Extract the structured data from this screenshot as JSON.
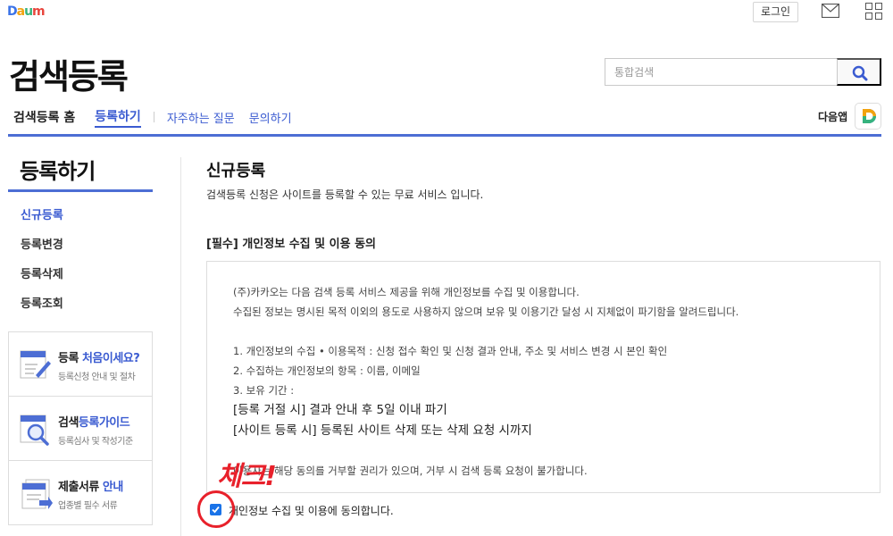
{
  "top": {
    "logo_text": "Daum",
    "login_label": "로그인"
  },
  "service_title": "검색등록",
  "search": {
    "placeholder": "통합검색"
  },
  "gnb": {
    "home": "검색등록 홈",
    "register": "등록하기",
    "faq": "자주하는 질문",
    "inquiry": "문의하기"
  },
  "app_link": "다음앱",
  "lnb": {
    "title": "등록하기",
    "items": [
      {
        "label": "신규등록",
        "active": true
      },
      {
        "label": "등록변경",
        "active": false
      },
      {
        "label": "등록삭제",
        "active": false
      },
      {
        "label": "등록조회",
        "active": false
      }
    ]
  },
  "guides": [
    {
      "title_prefix": "등록 ",
      "title_highlight": "처음이세요?",
      "title_suffix": "",
      "desc": "등록신청 안내 및 절차"
    },
    {
      "title_prefix": "검색",
      "title_highlight": "등록가이드",
      "title_suffix": "",
      "desc": "등록심사 및 작성기준"
    },
    {
      "title_prefix": "제출서류 ",
      "title_highlight": "안내",
      "title_suffix": "",
      "desc": "업종별 필수 서류"
    }
  ],
  "content": {
    "title": "신규등록",
    "desc": "검색등록 신청은 사이트를 등록할 수 있는 무료 서비스 입니다.",
    "consent_title": "[필수] 개인정보 수집 및 이용 동의",
    "terms": {
      "line1": "(주)카카오는 다음 검색 등록 서비스 제공을 위해 개인정보를 수집 및 이용합니다.",
      "line2": "수집된 정보는 명시된 목적 이외의 용도로 사용하지 않으며 보유 및 이용기간 달성 시 지체없이 파기함을 알려드립니다.",
      "line3": "1. 개인정보의 수집 • 이용목적 : 신청 접수 확인 및 신청 결과 안내, 주소 및 서비스 변경 시 본인 확인",
      "line4": "2. 수집하는 개인정보의 항목 : 이름, 이메일",
      "line5": "3. 보유 기간 :",
      "line6": "[등록 거절 시] 결과 안내 후 5일 이내 파기",
      "line7": "[사이트 등록 시] 등록된 사이트 삭제 또는 삭제 요청 시까지",
      "line8": "이용자는 해당 동의를 거부할 권리가 있으며, 거부 시 검색 등록 요청이 불가합니다."
    },
    "agree_label": "개인정보 수집 및 이용에 동의합니다.",
    "agree_checked": true
  },
  "annotation": {
    "text": "체크!",
    "color": "#e8212b"
  },
  "colors": {
    "accent": "#4d6ed4",
    "link": "#3a5bd1",
    "checkbox": "#1a73e8"
  }
}
